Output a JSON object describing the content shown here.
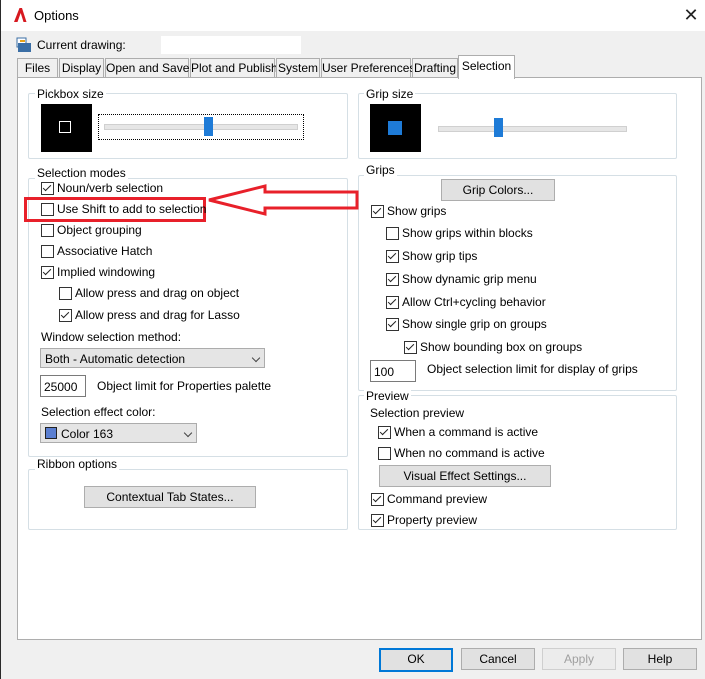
{
  "window": {
    "title": "Options",
    "close_glyph": "✕",
    "app_icon": "autocad-a-icon"
  },
  "drawing": {
    "label": "Current drawing:"
  },
  "tabs": [
    "Files",
    "Display",
    "Open and Save",
    "Plot and Publish",
    "System",
    "User Preferences",
    "Drafting",
    "Selection"
  ],
  "active_tab": "Selection",
  "pickbox": {
    "title": "Pickbox size",
    "level": 0.54
  },
  "selection_modes": {
    "title": "Selection modes",
    "noun_verb": {
      "label": "Noun/verb selection",
      "checked": true
    },
    "use_shift": {
      "label": "Use Shift to add to selection",
      "checked": false
    },
    "object_grouping": {
      "label": "Object grouping",
      "checked": false
    },
    "assoc_hatch": {
      "label": "Associative Hatch",
      "checked": false
    },
    "implied_windowing": {
      "label": "Implied windowing",
      "checked": true
    },
    "press_drag_object": {
      "label": "Allow press and drag on object",
      "checked": false
    },
    "press_drag_lasso": {
      "label": "Allow press and drag for Lasso",
      "checked": true
    },
    "window_method_label": "Window selection method:",
    "window_method_value": "Both - Automatic detection",
    "object_limit_value": "25000",
    "object_limit_label": "Object limit for Properties palette",
    "effect_color_label": "Selection effect color:",
    "effect_color_value": "Color 163",
    "effect_color_hex": "#5b7fd1"
  },
  "ribbon": {
    "title": "Ribbon options",
    "contextual_button": "Contextual Tab States..."
  },
  "grip_size": {
    "title": "Grip size",
    "level": 0.32
  },
  "grips": {
    "title": "Grips",
    "colors_button": "Grip Colors...",
    "show_grips": {
      "label": "Show grips",
      "checked": true
    },
    "within_blocks": {
      "label": "Show grips within blocks",
      "checked": false
    },
    "grip_tips": {
      "label": "Show grip tips",
      "checked": true
    },
    "dynamic_menu": {
      "label": "Show dynamic grip menu",
      "checked": true
    },
    "ctrl_cycling": {
      "label": "Allow Ctrl+cycling behavior",
      "checked": true
    },
    "single_grip": {
      "label": "Show single grip on groups",
      "checked": true
    },
    "bounding_box": {
      "label": "Show bounding box on groups",
      "checked": true
    },
    "limit_value": "100",
    "limit_label": "Object selection limit for display of grips"
  },
  "preview": {
    "title": "Preview",
    "selection_preview_label": "Selection preview",
    "command_active": {
      "label": "When a command is active",
      "checked": true
    },
    "no_command": {
      "label": "When no command is active",
      "checked": false
    },
    "visual_effect_button": "Visual Effect Settings...",
    "command_preview": {
      "label": "Command preview",
      "checked": true
    },
    "property_preview": {
      "label": "Property preview",
      "checked": true
    }
  },
  "buttons": {
    "ok": "OK",
    "cancel": "Cancel",
    "apply": "Apply",
    "help": "Help"
  },
  "colors": {
    "accent": "#0078d7",
    "slider": "#1e7bd7",
    "grip": "#1e7bd7",
    "annotation": "#e8202a"
  }
}
